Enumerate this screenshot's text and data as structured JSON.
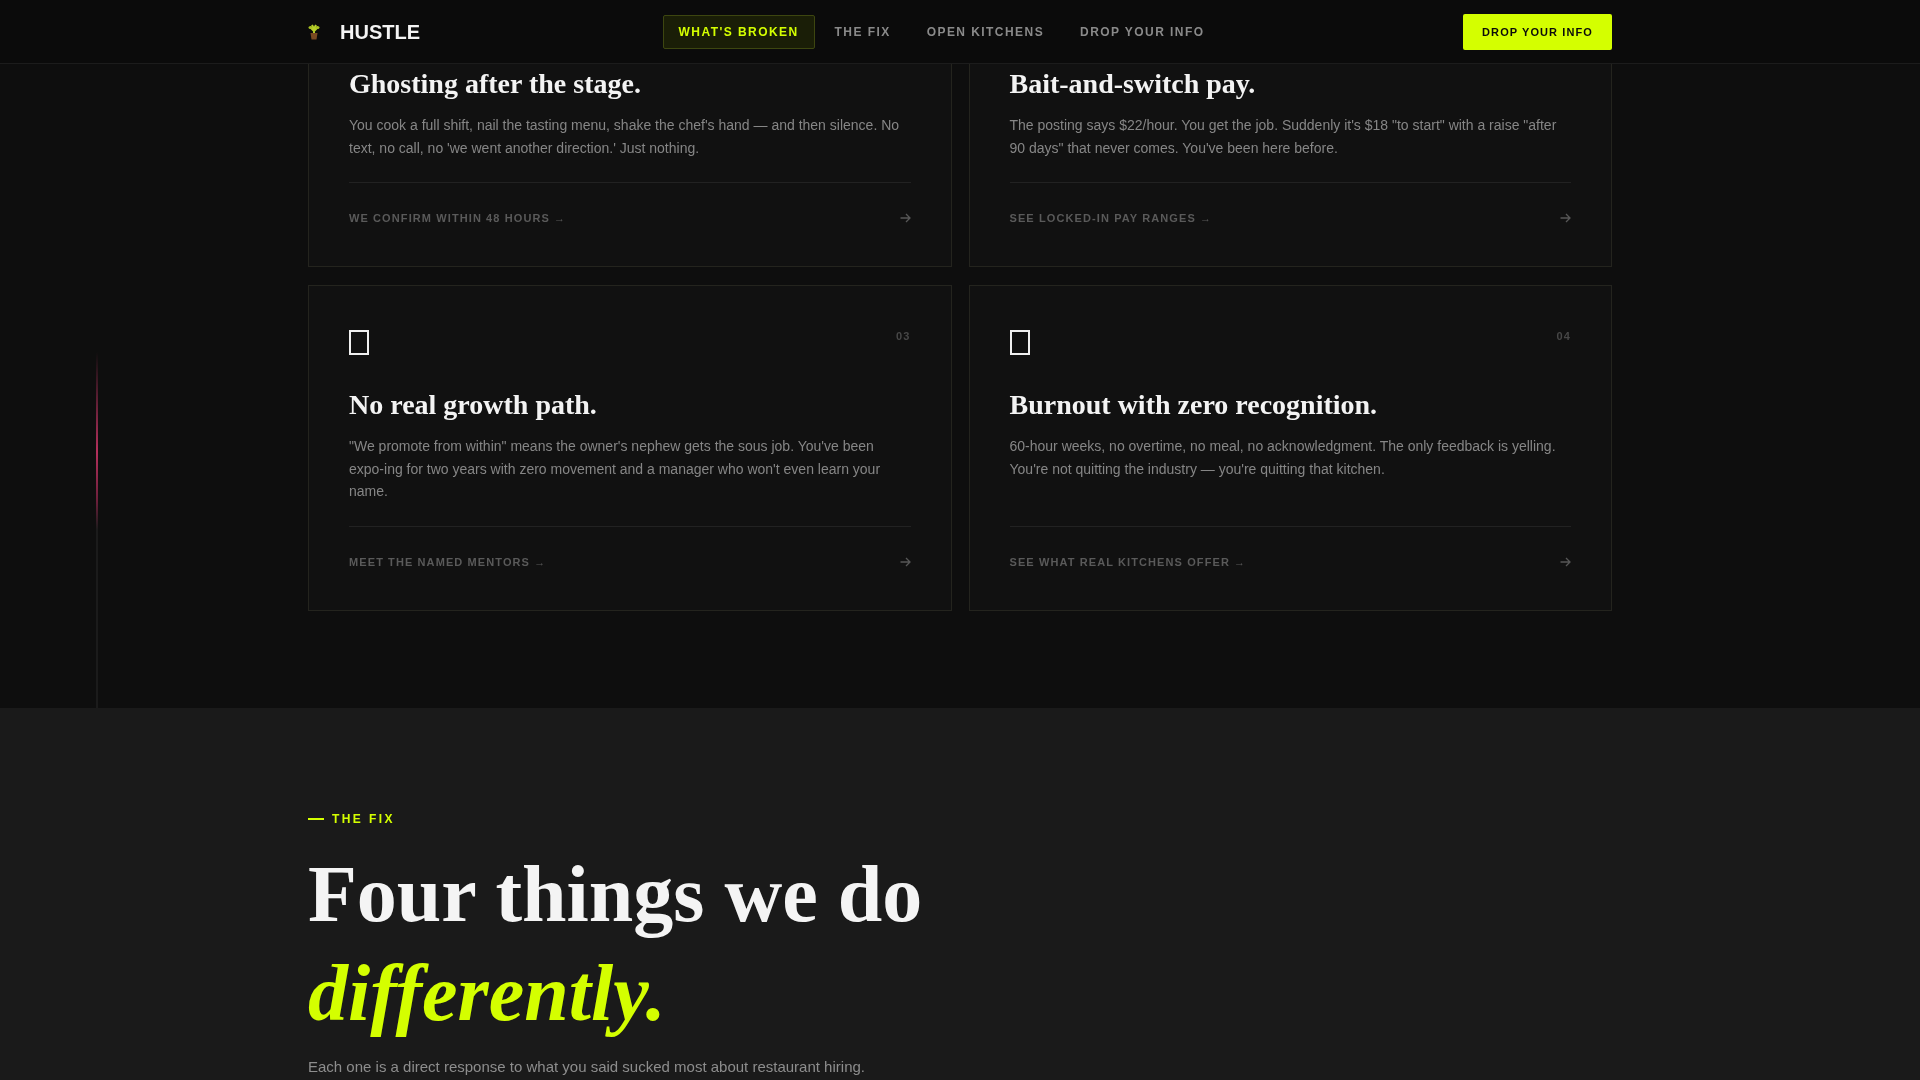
{
  "navbar": {
    "brand": "HUSTLE",
    "links": [
      {
        "label": "WHAT'S BROKEN",
        "selected": true
      },
      {
        "label": "THE FIX",
        "selected": false
      },
      {
        "label": "OPEN KITCHENS",
        "selected": false
      },
      {
        "label": "DROP YOUR INFO",
        "selected": false
      }
    ],
    "cta": "DROP YOUR INFO"
  },
  "problems": [
    {
      "title": "Ghosting after the stage.",
      "text": "You cook a full shift, nail the tasting menu, shake the chef's hand — and then silence. No text, no call, no 'we went another direction.' Just nothing.",
      "link": "WE CONFIRM WITHIN 48 HOURS →"
    },
    {
      "title": "Bait-and-switch pay.",
      "text": "The posting says $22/hour. You get the job. Suddenly it's $18 \"to start\" with a raise \"after 90 days\" that never comes. You've been here before.",
      "link": "SEE LOCKED-IN PAY RANGES →"
    },
    {
      "number": "03",
      "title": "No real growth path.",
      "text": "\"We promote from within\" means the owner's nephew gets the sous job. You've been expo-ing for two years with zero movement and a manager who won't even learn your name.",
      "link": "MEET THE NAMED MENTORS →"
    },
    {
      "number": "04",
      "title": "Burnout with zero recognition.",
      "text": "60-hour weeks, no overtime, no meal, no acknowledgment. The only feedback is yelling. You're not quitting the industry — you're quitting that kitchen.",
      "link": "SEE WHAT REAL KITCHENS OFFER →"
    }
  ],
  "fix": {
    "eyebrow": "THE FIX",
    "heading": "Four things we do *differently.*",
    "lead": "Each one is a direct response to what you said sucked most about restaurant hiring."
  }
}
